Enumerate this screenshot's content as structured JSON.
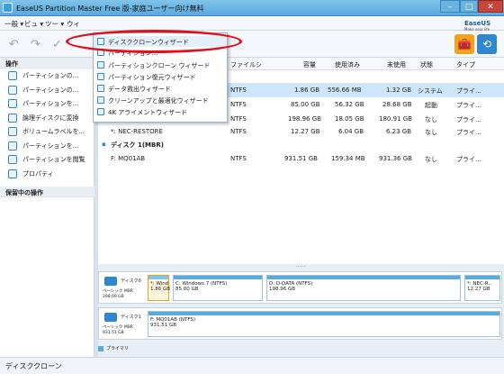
{
  "window": {
    "title": "EaseUS Partition Master Free 版-家庭ユーザー向け無料",
    "min_label": "–",
    "max_label": "□",
    "close_label": "✕"
  },
  "logo": {
    "text": "EaseUS",
    "sub": "Make your life easy"
  },
  "menu": {
    "items": [
      "一般 ▾",
      "ビュ ▾",
      "ツー ▾",
      "ウィ"
    ]
  },
  "toolbar": {
    "undo_glyph": "↶",
    "redo_glyph": "↷",
    "apply_glyph": "✓",
    "tools_glyph": "🧰",
    "sync_glyph": "⟲"
  },
  "left_panel": {
    "operations_header": "操作",
    "operations": [
      "パーティションの...",
      "パーティションの...",
      "パーティションを...",
      "論理ディスクに変換",
      "ボリュームラベルを...",
      "パーティションを...",
      "パーティションを閲覧",
      "プロパティ"
    ],
    "pending_header": "保留中の操作"
  },
  "dropdown": {
    "items": [
      "ディスククローンウィザード",
      "パーティション...",
      "パーティションクローン ウィザード",
      "パーティション復元ウィザード",
      "データ救出ウィザード",
      "クリーンアップと最適化ウィザード",
      "4K アライメントウィザード"
    ]
  },
  "table": {
    "headers": [
      "ファイルシ",
      "容量",
      "使用済み",
      "未使用",
      "状態",
      "タイプ"
    ],
    "rows": [
      {
        "name": "",
        "fs": "NTFS",
        "cap": "1.86 GB",
        "used": "556.66 MB",
        "free": "1.32 GB",
        "status": "システム",
        "type": "プライ..."
      },
      {
        "name": "",
        "fs": "NTFS",
        "cap": "85.00 GB",
        "used": "56.32 GB",
        "free": "28.68 GB",
        "status": "起動",
        "type": "プライ..."
      },
      {
        "name": "",
        "fs": "NTFS",
        "cap": "198.96 GB",
        "used": "18.05 GB",
        "free": "180.91 GB",
        "status": "なし",
        "type": "プライ..."
      },
      {
        "name": "*: NEC-RESTORE",
        "fs": "NTFS",
        "cap": "12.27 GB",
        "used": "6.04 GB",
        "free": "6.23 GB",
        "status": "なし",
        "type": "プライ..."
      }
    ],
    "disk1_header": "ディスク 1(MBR)",
    "disk1_row": {
      "name": "F: MQ01AB",
      "fs": "NTFS",
      "cap": "931.51 GB",
      "used": "159.34 MB",
      "free": "931.36 GB",
      "status": "なし",
      "type": "プライ..."
    }
  },
  "splitter": "......",
  "disk_map": {
    "disk0": {
      "name": "ディスク0",
      "type": "ベーシック MBR",
      "size": "298.09 GB",
      "partitions": [
        {
          "label": "*: Wind...",
          "size": "1.86 GB"
        },
        {
          "label": "C: Windows 7 (NTFS)",
          "size": "85.00 GB"
        },
        {
          "label": "D: D-DATA (NTFS)",
          "size": "198.96 GB"
        },
        {
          "label": "*: NEC-R...",
          "size": "12.27 GB"
        }
      ]
    },
    "disk1": {
      "name": "ディスク1",
      "type": "ベーシック MBR",
      "size": "931.51 GB",
      "partitions": [
        {
          "label": "F: MQ01AB (NTFS)",
          "size": "931.51 GB"
        }
      ]
    },
    "legend": "プライマリ"
  },
  "status": {
    "text": "ディスククローン"
  }
}
